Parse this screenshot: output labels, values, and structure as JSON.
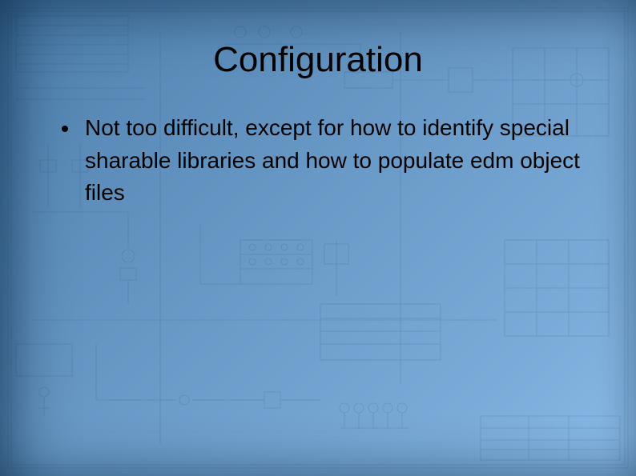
{
  "slide": {
    "title": "Configuration",
    "bullets": [
      "Not too difficult, except for how to identify special sharable libraries and how to populate edm object files"
    ]
  }
}
